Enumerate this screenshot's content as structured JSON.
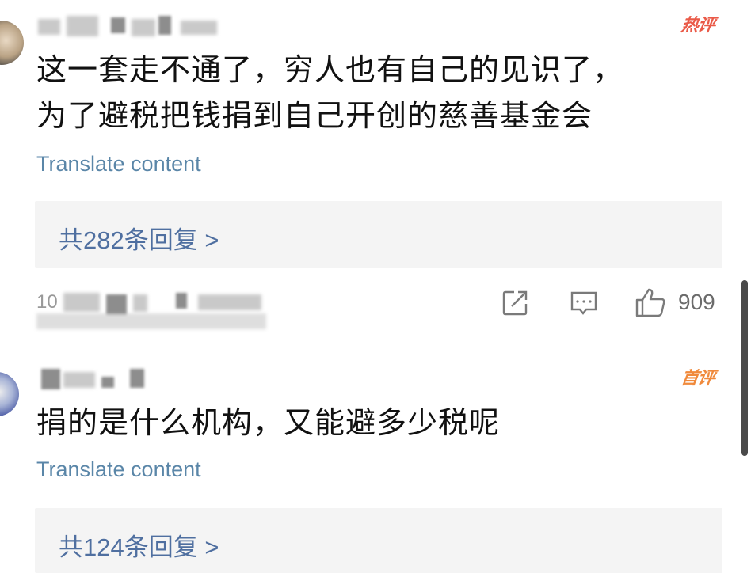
{
  "comments": [
    {
      "badge": "热评",
      "lines": [
        "这一套走不通了，穷人也有自己的见识了，",
        "为了避税把钱捐到自己开创的慈善基金会"
      ],
      "translate": "Translate content",
      "replies": "共282条回复 >",
      "timestamp_partial": "10",
      "likes": "909"
    },
    {
      "badge": "首评",
      "lines": [
        "捐的是什么机构，又能避多少税呢"
      ],
      "translate": "Translate content",
      "replies": "共124条回复 >"
    }
  ],
  "icons": {
    "share": "share-icon",
    "comment": "comment-icon",
    "like": "like-icon"
  },
  "colors": {
    "hot_badge": "#ea5a48",
    "first_badge": "#f08a3c",
    "link_blue": "#4f6fa0",
    "translate_blue": "#5a86a8",
    "reply_bg": "#f4f4f4"
  }
}
